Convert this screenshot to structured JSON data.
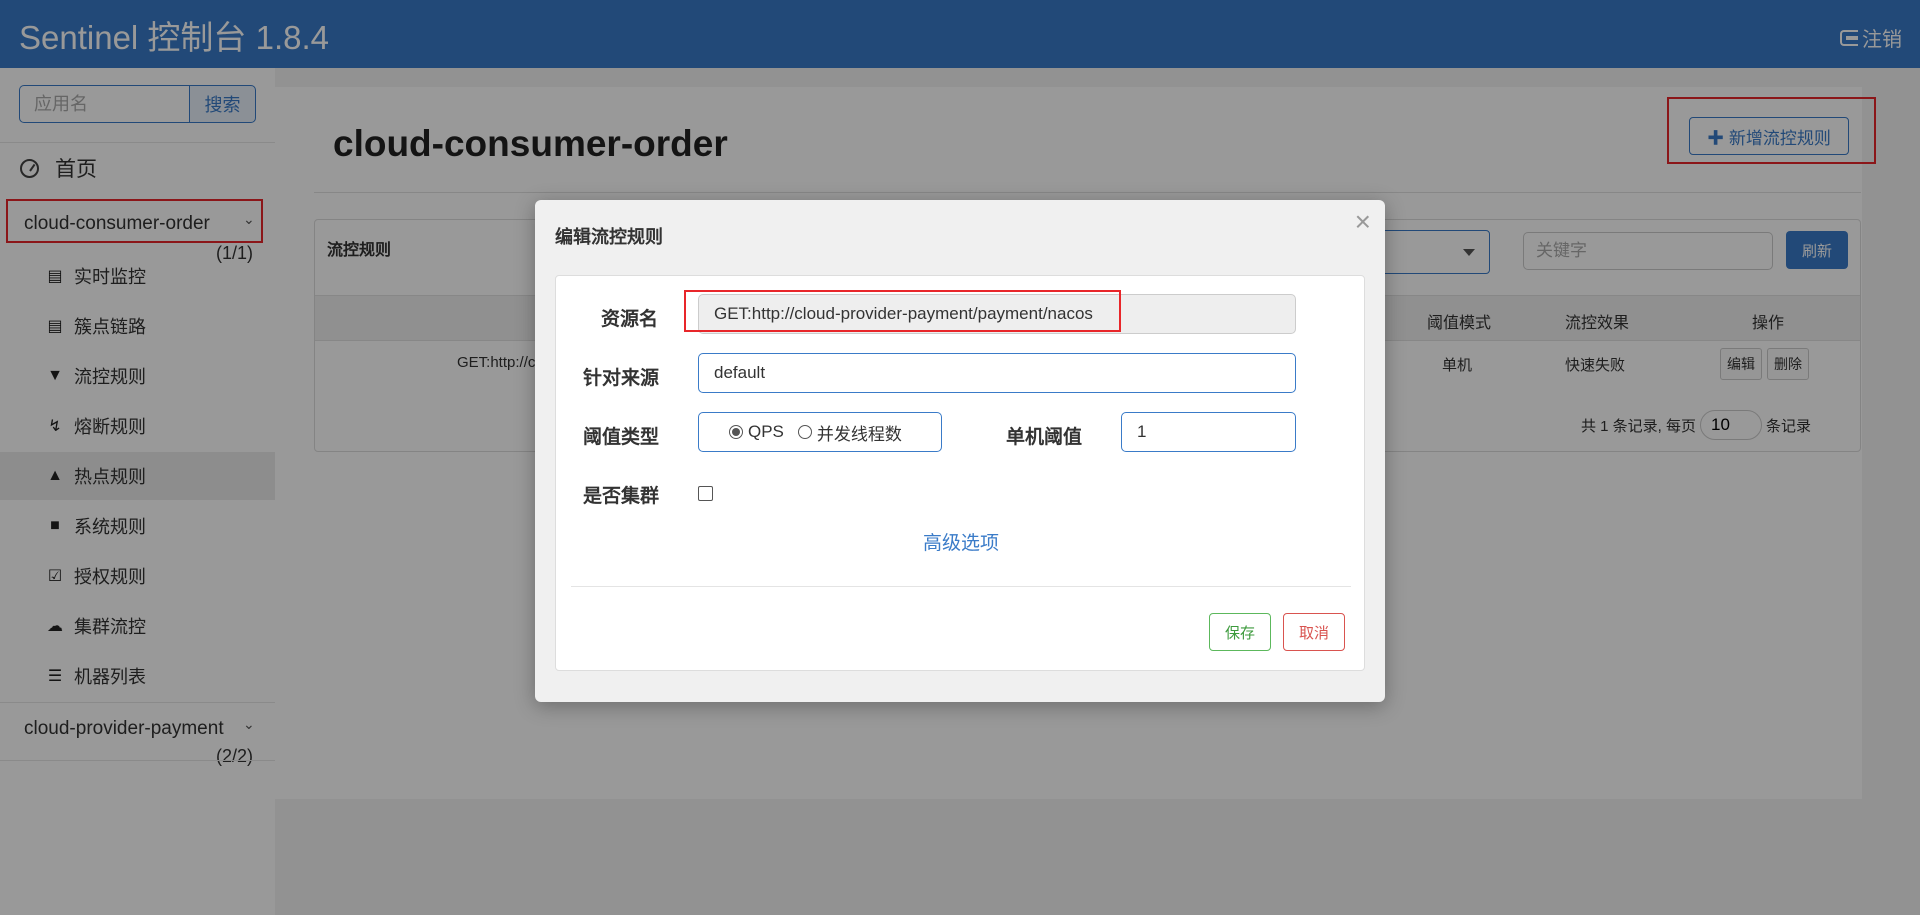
{
  "header": {
    "brand": "Sentinel 控制台 1.8.4",
    "logout_label": "注销"
  },
  "sidebar": {
    "search_placeholder": "应用名",
    "search_button": "搜索",
    "home_label": "首页",
    "apps": [
      {
        "name": "cloud-consumer-order",
        "count": "(1/1)"
      },
      {
        "name": "cloud-provider-payment",
        "count": "(2/2)"
      }
    ],
    "menu": [
      {
        "label": "实时监控",
        "icon": "bar-chart-icon"
      },
      {
        "label": "簇点链路",
        "icon": "list-icon"
      },
      {
        "label": "流控规则",
        "icon": "filter-icon"
      },
      {
        "label": "熔断规则",
        "icon": "bolt-icon"
      },
      {
        "label": "热点规则",
        "icon": "fire-icon"
      },
      {
        "label": "系统规则",
        "icon": "lock-icon"
      },
      {
        "label": "授权规则",
        "icon": "check-square-icon"
      },
      {
        "label": "集群流控",
        "icon": "cloud-icon"
      },
      {
        "label": "机器列表",
        "icon": "th-list-icon"
      }
    ]
  },
  "main": {
    "title": "cloud-consumer-order",
    "add_button": "新增流控规则",
    "panel_title": "流控规则",
    "keyword_placeholder": "关键字",
    "refresh_button": "刷新",
    "columns": {
      "mode": "阈值模式",
      "effect": "流控效果",
      "ops": "操作"
    },
    "row": {
      "resource": "GET:http://c",
      "mode": "单机",
      "effect": "快速失败",
      "edit": "编辑",
      "delete": "删除"
    },
    "pager": {
      "prefix": "共 1 条记录, 每页",
      "page_size": "10",
      "suffix": "条记录"
    }
  },
  "modal": {
    "title": "编辑流控规则",
    "close": "×",
    "resource_label": "资源名",
    "resource_value": "GET:http://cloud-provider-payment/payment/nacos",
    "origin_label": "针对来源",
    "origin_value": "default",
    "threshold_type_label": "阈值类型",
    "radio_qps": "QPS",
    "radio_threads": "并发线程数",
    "threshold_label": "单机阈值",
    "threshold_value": "1",
    "cluster_label": "是否集群",
    "advanced_link": "高级选项",
    "save_button": "保存",
    "cancel_button": "取消"
  },
  "colors": {
    "header": "#3a7bc8",
    "highlight": "#e8262a"
  }
}
